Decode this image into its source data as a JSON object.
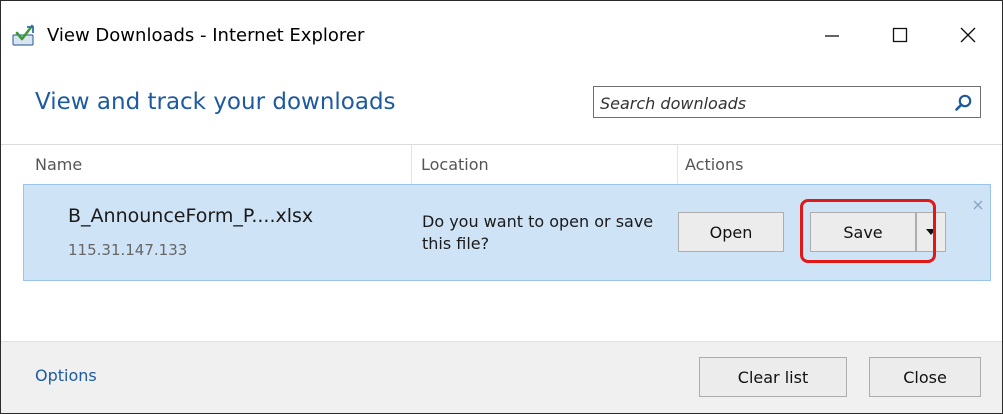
{
  "window": {
    "title": "View Downloads - Internet Explorer",
    "app_icon": "ie-downloads-icon"
  },
  "header": {
    "title": "View and track your downloads",
    "search": {
      "placeholder": "Search downloads",
      "value": "",
      "icon": "search-icon"
    }
  },
  "columns": {
    "name": "Name",
    "location": "Location",
    "actions": "Actions"
  },
  "downloads": [
    {
      "file_name": "B_AnnounceForm_P....xlsx",
      "source": "115.31.147.133",
      "prompt": "Do you want to open or save this file?",
      "open_label": "Open",
      "save_label": "Save",
      "save_highlighted": true
    }
  ],
  "footer": {
    "options_label": "Options",
    "clear_label": "Clear list",
    "close_label": "Close"
  },
  "colors": {
    "accent": "#1e5aa0",
    "row_highlight": "#cfe3f7",
    "callout": "#e01818"
  }
}
